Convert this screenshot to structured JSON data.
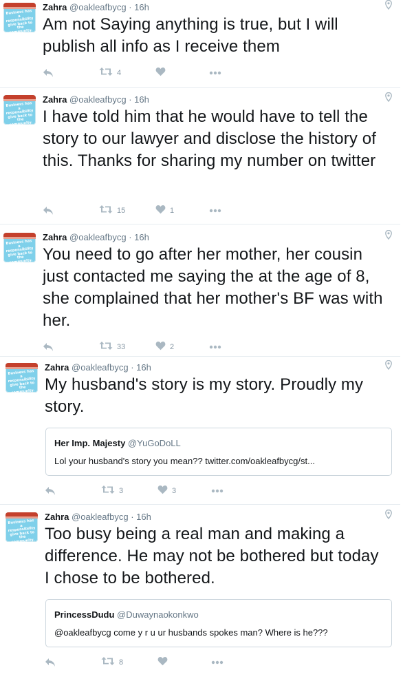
{
  "colors": {
    "icon": "#aab8c2",
    "text": "#14171a",
    "muted": "#657786",
    "border": "#e6ecf0",
    "avatar_bg": "#7fd0ea"
  },
  "avatar_text": "Business has a responsibility give back to the community.",
  "tweets": [
    {
      "name": "Zahra",
      "handle": "@oakleafbycg",
      "time": "· 16h",
      "text": "Am not Saying anything is true, but I will publish all info as I receive them",
      "retweets": "4",
      "likes": ""
    },
    {
      "name": "Zahra",
      "handle": "@oakleafbycg",
      "time": "· 16h",
      "text": "I have told him that he would have to tell the story to our lawyer and disclose the history of this. Thanks for sharing my number on twitter",
      "retweets": "15",
      "likes": "1"
    },
    {
      "name": "Zahra",
      "handle": "@oakleafbycg",
      "time": "· 16h",
      "text": "You need to go after her mother, her cousin just contacted me saying the at the age of 8, she complained that her mother's BF was with her.",
      "retweets": "33",
      "likes": "2"
    },
    {
      "name": "Zahra",
      "handle": "@oakleafbycg",
      "time": "· 16h",
      "text": "My husband's story is my story. Proudly my story.",
      "quote": {
        "name": "Her Imp. Majesty",
        "handle": "@YuGoDoLL",
        "text": "Lol your husband's story you mean?? twitter.com/oakleafbycg/st..."
      },
      "retweets": "3",
      "likes": "3"
    },
    {
      "name": "Zahra",
      "handle": "@oakleafbycg",
      "time": "· 16h",
      "text": "Too busy being a real man and making a difference. He may not be bothered but today I chose to be bothered.",
      "quote": {
        "name": "PrincessDudu",
        "handle": "@Duwaynaokonkwo",
        "text": "@oakleafbycg  come y r u ur husbands spokes man? Where is he???"
      },
      "retweets": "8",
      "likes": ""
    }
  ]
}
